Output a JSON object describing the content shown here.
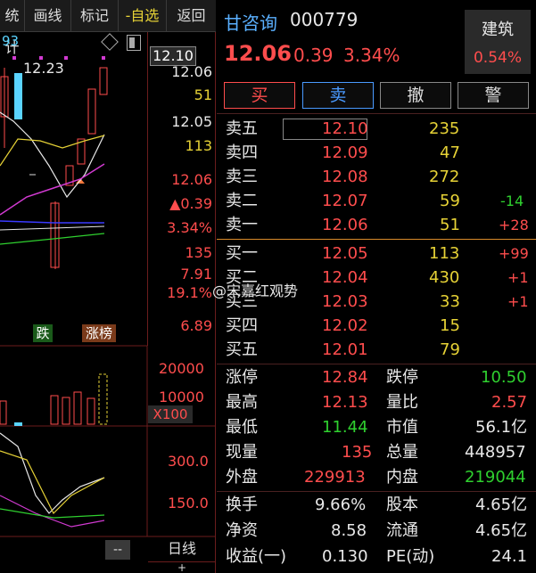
{
  "toolbar": {
    "items": [
      {
        "label": "统计",
        "active": false
      },
      {
        "label": "画线",
        "active": false
      },
      {
        "label": "标记",
        "active": false
      },
      {
        "label": "-自选",
        "active": true
      },
      {
        "label": "返回",
        "active": false
      }
    ]
  },
  "chart": {
    "top_left_value": "93",
    "high_marker": "12.23",
    "price_axis": {
      "current_tag": "12.10",
      "labels": [
        "12.06",
        "51",
        "12.05",
        "113",
        "12.06",
        "▲0.39",
        "3.34%",
        "135",
        "7.91",
        "19.1%",
        "6.89"
      ]
    },
    "badges": {
      "fall": "跌",
      "limit_list": "涨榜"
    },
    "volume_axis": {
      "labels": [
        "20000",
        "10000"
      ],
      "unit": "X100"
    },
    "indicator_axis": {
      "labels": [
        "300.0",
        "150.0"
      ]
    },
    "bottom": {
      "dash_box": "--",
      "period": "日线",
      "plus": "+"
    }
  },
  "stock": {
    "name": "甘咨询",
    "code": "000779",
    "price": "12.06",
    "change": "0.39",
    "change_pct": "3.34%",
    "sector": "建筑",
    "sector_pct": "0.54%"
  },
  "actions": {
    "buy": "买",
    "sell": "卖",
    "cancel": "撤",
    "alert": "警"
  },
  "order_book": {
    "asks": [
      {
        "label": "卖五",
        "price": "12.10",
        "volume": "235",
        "delta": ""
      },
      {
        "label": "卖四",
        "price": "12.09",
        "volume": "47",
        "delta": ""
      },
      {
        "label": "卖三",
        "price": "12.08",
        "volume": "272",
        "delta": ""
      },
      {
        "label": "卖二",
        "price": "12.07",
        "volume": "59",
        "delta": "-14"
      },
      {
        "label": "卖一",
        "price": "12.06",
        "volume": "51",
        "delta": "+28"
      }
    ],
    "bids": [
      {
        "label": "买一",
        "price": "12.05",
        "volume": "113",
        "delta": "+99"
      },
      {
        "label": "买二",
        "price": "12.04",
        "volume": "430",
        "delta": "+1"
      },
      {
        "label": "买三",
        "price": "12.03",
        "volume": "33",
        "delta": "+1"
      },
      {
        "label": "买四",
        "price": "12.02",
        "volume": "15",
        "delta": ""
      },
      {
        "label": "买五",
        "price": "12.01",
        "volume": "79",
        "delta": ""
      }
    ]
  },
  "watermark": "@宋嘉红观势",
  "stats": {
    "limit_up_label": "涨停",
    "limit_up": "12.84",
    "limit_down_label": "跌停",
    "limit_down": "10.50",
    "high_label": "最高",
    "high": "12.13",
    "vol_ratio_label": "量比",
    "vol_ratio": "2.57",
    "low_label": "最低",
    "low": "11.44",
    "mkt_cap_label": "市值",
    "mkt_cap": "56.1亿",
    "cur_vol_label": "现量",
    "cur_vol": "135",
    "total_vol_label": "总量",
    "total_vol": "448957",
    "outer_label": "外盘",
    "outer": "229913",
    "inner_label": "内盘",
    "inner": "219044",
    "turnover_label": "换手",
    "turnover": "9.66%",
    "shares_label": "股本",
    "shares": "4.65亿",
    "nav_label": "净资",
    "nav": "8.58",
    "float_label": "流通",
    "float": "4.65亿",
    "eps_label": "收益(一)",
    "eps": "0.130",
    "pe_label": "PE(动)",
    "pe": "24.1"
  },
  "colors": {
    "up": "#ff4d4d",
    "down": "#2fd02f",
    "accent": "#e6d236",
    "bg": "#000000"
  }
}
